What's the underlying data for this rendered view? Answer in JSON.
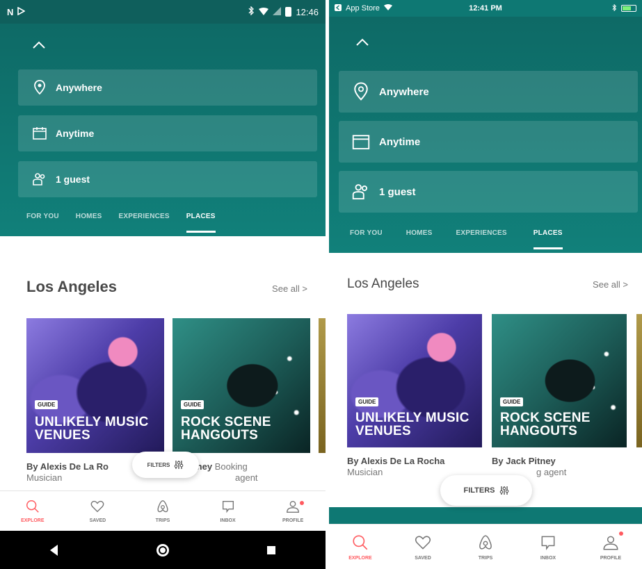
{
  "colors": {
    "teal": "#0e7873",
    "accent": "#ff5a5f",
    "text": "#484848",
    "muted": "#767676"
  },
  "android": {
    "status_bar": {
      "icons": [
        "N",
        "play-store",
        "bluetooth",
        "wifi",
        "signal",
        "battery"
      ],
      "time": "12:46"
    },
    "search": {
      "collapse_icon": "chevron-up-icon",
      "location": "Anywhere",
      "dates": "Anytime",
      "guests": "1 guest"
    },
    "tabs": [
      "FOR YOU",
      "HOMES",
      "EXPERIENCES",
      "PLACES"
    ],
    "active_tab": "PLACES",
    "section": {
      "title": "Los Angeles",
      "see_all": "See all >"
    },
    "cards": [
      {
        "badge": "GUIDE",
        "title": "UNLIKELY MUSIC VENUES",
        "author": "By Alexis De La Ro",
        "role": "Musician"
      },
      {
        "badge": "GUIDE",
        "title": "ROCK SCENE HANGOUTS",
        "author": "ck Pitney",
        "role": "Booking",
        "role_line2": "agent"
      }
    ],
    "filters": "FILTERS",
    "tab_bar": [
      "EXPLORE",
      "SAVED",
      "TRIPS",
      "INBOX",
      "PROFILE"
    ],
    "nav_bar": [
      "back-icon",
      "home-icon",
      "recents-icon"
    ]
  },
  "ios": {
    "status_bar": {
      "carrier": "App Store",
      "time": "12:41 PM"
    },
    "search": {
      "collapse_icon": "chevron-up-icon",
      "location": "Anywhere",
      "dates": "Anytime",
      "guests": "1 guest"
    },
    "tabs": [
      "FOR YOU",
      "HOMES",
      "EXPERIENCES",
      "PLACES"
    ],
    "active_tab": "PLACES",
    "section": {
      "title": "Los Angeles",
      "see_all": "See all >"
    },
    "cards": [
      {
        "badge": "GUIDE",
        "title": "UNLIKELY MUSIC VENUES",
        "author": "By Alexis De La Rocha",
        "role": "Musician"
      },
      {
        "badge": "GUIDE",
        "title": "ROCK SCENE HANGOUTS",
        "author": "By Jack Pitney",
        "role": "g agent"
      }
    ],
    "filters": "FILTERS",
    "tab_bar": [
      "EXPLORE",
      "SAVED",
      "TRIPS",
      "INBOX",
      "PROFILE"
    ]
  }
}
